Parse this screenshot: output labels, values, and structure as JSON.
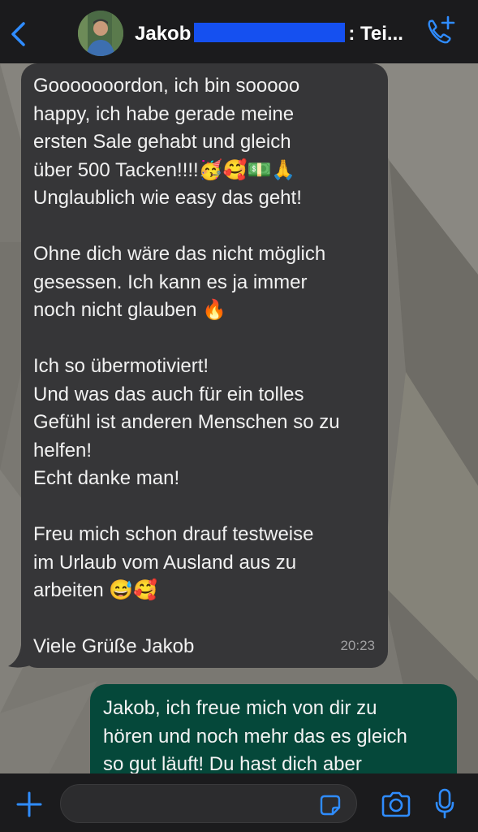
{
  "header": {
    "contact_name_start": "Jakob",
    "contact_name_end": ": Tei...",
    "accent": "#2f8cff"
  },
  "messages": {
    "incoming": {
      "paragraphs": [
        [
          "Gooooooordon, ich bin sooooo",
          "happy, ich habe gerade meine",
          "ersten Sale gehabt  und gleich",
          "über 500 Tacken!!!!🥳🥰💵🙏",
          "Unglaublich wie easy das geht!"
        ],
        [
          "Ohne dich wäre das nicht möglich",
          "gesessen. Ich kann es ja immer",
          "noch nicht glauben 🔥"
        ],
        [
          "Ich so übermotiviert!",
          "Und was das auch für ein tolles",
          "Gefühl ist anderen Menschen so zu",
          "helfen!",
          "Echt danke man!"
        ],
        [
          "Freu mich schon drauf testweise",
          "im Urlaub vom Ausland aus zu",
          "arbeiten 😅🥰"
        ],
        [
          "Viele Grüße Jakob"
        ]
      ],
      "time": "20:23"
    },
    "outgoing": {
      "lines": [
        "Jakob, ich freue mich von dir zu",
        "hören und noch mehr das es gleich",
        "so gut läuft! Du hast dich aber"
      ]
    }
  },
  "colors": {
    "incoming_bubble": "#363638",
    "outgoing_bubble": "#05483a",
    "bar": "#1b1b1d",
    "icon_blue": "#2f8cff"
  }
}
